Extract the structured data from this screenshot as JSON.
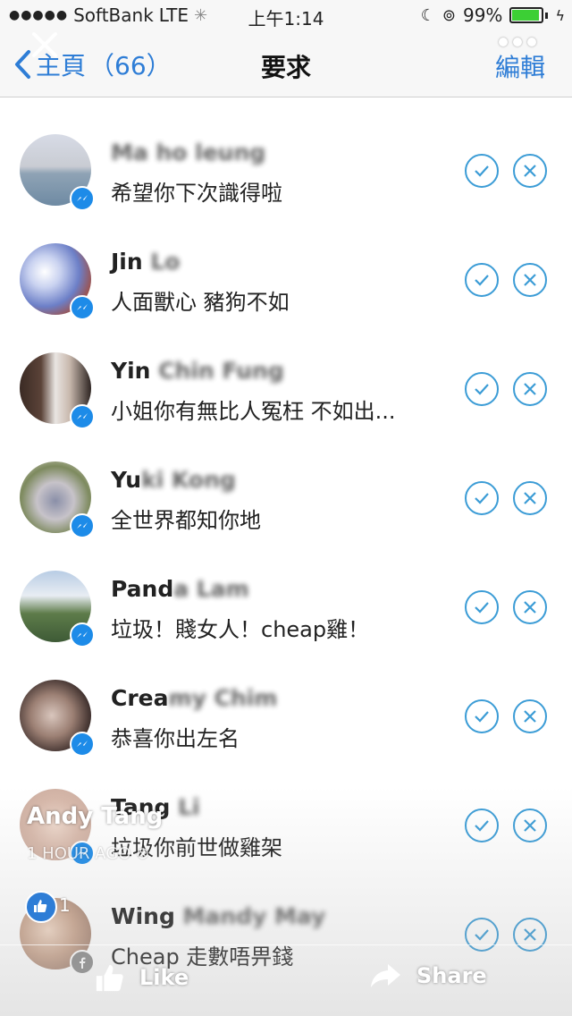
{
  "status_bar": {
    "signal": "●●●●●",
    "carrier": "SoftBank",
    "network": "LTE",
    "time": "上午1:14",
    "battery": "99%",
    "battery_level": 0.99
  },
  "nav": {
    "back_label": "主頁",
    "count": "（66）",
    "title": "要求",
    "edit_label": "編輯"
  },
  "requests": [
    {
      "name": "",
      "message": "希望你下次識得啦"
    },
    {
      "name": "Jin",
      "message": "人面獸心 豬狗不如"
    },
    {
      "name": "Yin",
      "message": "小姐你有無比人冤枉 不如出..."
    },
    {
      "name": "Yu",
      "message": "全世界都知你地"
    },
    {
      "name": "Pand",
      "message": "垃圾！賤女人！cheap雞！"
    },
    {
      "name": "Crea",
      "message": "恭喜你出左名"
    },
    {
      "name": "Tang",
      "message": "垃圾你前世做雞架"
    },
    {
      "name": "Wing",
      "message": "Cheap 走數唔畀錢"
    }
  ],
  "live": {
    "broadcaster": "Andy Tang",
    "time_ago": "1 HOUR AGO",
    "like_count": "1",
    "like_label": "Like",
    "share_label": "Share"
  },
  "colors": {
    "accent": "#2e7dd6",
    "button_ring": "#3b9cd6",
    "messenger": "#1d8be8"
  }
}
